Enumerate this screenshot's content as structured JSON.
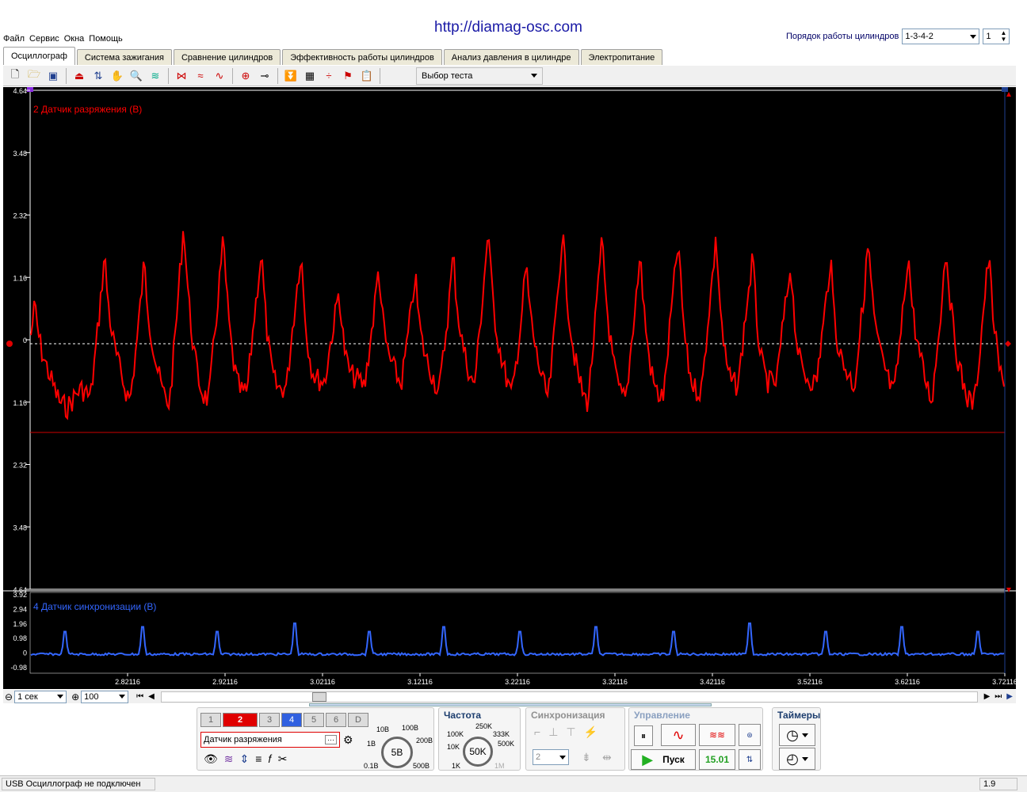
{
  "header": {
    "url_banner": "http://diamag-osc.com"
  },
  "menu": {
    "items": [
      "Файл",
      "Сервис",
      "Окна",
      "Помощь"
    ]
  },
  "cylinder_order": {
    "label": "Порядок работы цилиндров",
    "value": "1-3-4-2",
    "count": "1"
  },
  "tabs": [
    "Осциллограф",
    "Система зажигания",
    "Сравнение цилиндров",
    "Эффективность работы цилиндров",
    "Анализ давления в цилиндре",
    "Электропитание"
  ],
  "toolbar": {
    "test_select_label": "Выбор теста"
  },
  "channel_main": {
    "title": "2 Датчик разряжения (В)",
    "color": "#ff0000",
    "y_ticks": [
      "4.64",
      "3.48",
      "2.32",
      "1.16",
      "0",
      "1.16",
      "2.32",
      "3.48",
      "4.64"
    ]
  },
  "channel_sync": {
    "title": "4 Датчик синхронизации (В)",
    "color": "#3366ff",
    "y_ticks": [
      "3.92",
      "2.94",
      "1.96",
      "0.98",
      "0",
      "-0.98"
    ]
  },
  "x_ticks": [
    "2.82116",
    "2.92116",
    "3.02116",
    "3.12116",
    "3.22116",
    "3.32116",
    "3.42116",
    "3.52116",
    "3.62116",
    "3.72116"
  ],
  "timebar": {
    "scale": "1 сек",
    "zoom": "100"
  },
  "channels_panel": {
    "buttons": [
      "1",
      "2",
      "3",
      "4",
      "5",
      "6",
      "D"
    ],
    "sensor": "Датчик разряжения",
    "volt_labels": [
      "10В",
      "100В",
      "1В",
      "200В",
      "0.1В",
      "500В"
    ],
    "volt_value": "5В"
  },
  "freq_panel": {
    "title": "Частота",
    "labels": [
      "250K",
      "100K",
      "333K",
      "10K",
      "500K",
      "1K",
      "1M"
    ],
    "value": "50K"
  },
  "sync_panel": {
    "title": "Синхронизация",
    "channel": "2"
  },
  "control_panel": {
    "title": "Управление",
    "start_label": "Пуск",
    "counter": "15.01"
  },
  "timers_panel": {
    "title": "Таймеры"
  },
  "status": {
    "message": "USB Осциллограф не подключен",
    "version": "1.9"
  }
}
